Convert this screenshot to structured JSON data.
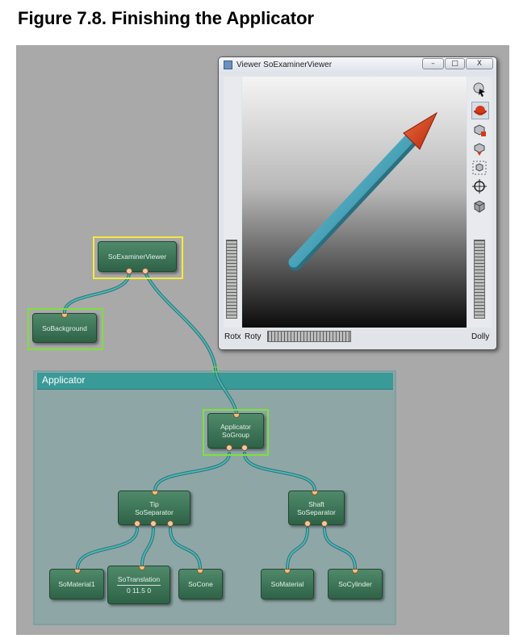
{
  "figure": {
    "caption": "Figure 7.8. Finishing the Applicator"
  },
  "viewer": {
    "title": "Viewer SoExaminerViewer",
    "window_buttons": {
      "minimize": "–",
      "maximize": "□",
      "close": "X"
    },
    "tools": [
      {
        "name": "pick-arrow-icon"
      },
      {
        "name": "rotate-view-icon"
      },
      {
        "name": "home-icon"
      },
      {
        "name": "set-home-icon"
      },
      {
        "name": "view-all-icon"
      },
      {
        "name": "seek-icon"
      },
      {
        "name": "projection-cube-icon"
      }
    ],
    "labels": {
      "rotx": "Rotx",
      "roty": "Roty",
      "dolly": "Dolly"
    },
    "model_colors": {
      "shaft": "#4aa3b8",
      "tip": "#d33a1c"
    }
  },
  "graph": {
    "group_title": "Applicator",
    "nodes": {
      "examiner_viewer": "SoExaminerViewer",
      "background": "SoBackground",
      "applicator": {
        "line1": "Applicator",
        "line2": "SoGroup"
      },
      "tip": {
        "line1": "Tip",
        "line2": "SoSeparator"
      },
      "shaft": {
        "line1": "Shaft",
        "line2": "SoSeparator"
      },
      "material1": "SoMaterial1",
      "translation": {
        "name": "SoTranslation",
        "value": "0 11.5 0"
      },
      "cone": "SoCone",
      "material": "SoMaterial",
      "cylinder": "SoCylinder"
    },
    "colors": {
      "selection_yellow": "#f5ea3a",
      "selection_green": "#7ee03c",
      "wire": "#3f9fa0",
      "node": "#3c7657"
    }
  }
}
